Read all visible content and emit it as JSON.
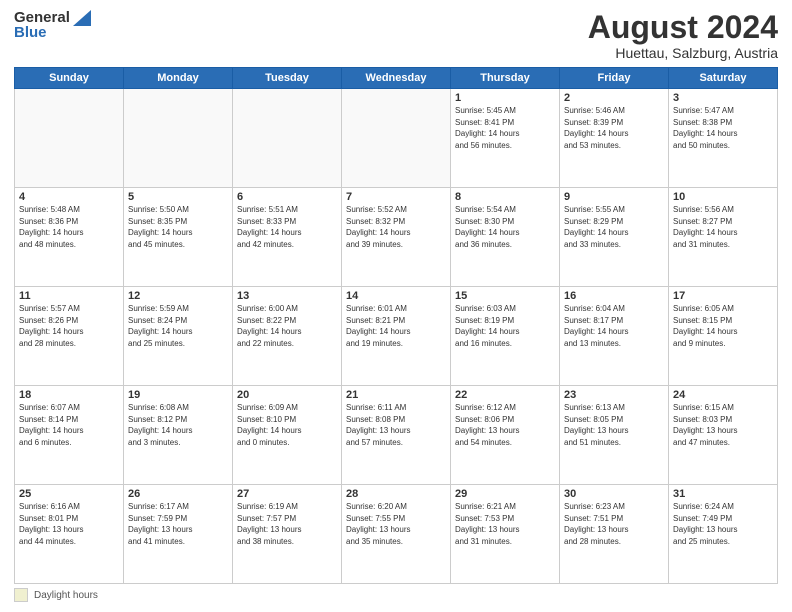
{
  "header": {
    "logo_general": "General",
    "logo_blue": "Blue",
    "month_year": "August 2024",
    "location": "Huettau, Salzburg, Austria"
  },
  "footer": {
    "daylight_label": "Daylight hours"
  },
  "weekdays": [
    "Sunday",
    "Monday",
    "Tuesday",
    "Wednesday",
    "Thursday",
    "Friday",
    "Saturday"
  ],
  "weeks": [
    [
      {
        "day": "",
        "info": ""
      },
      {
        "day": "",
        "info": ""
      },
      {
        "day": "",
        "info": ""
      },
      {
        "day": "",
        "info": ""
      },
      {
        "day": "1",
        "info": "Sunrise: 5:45 AM\nSunset: 8:41 PM\nDaylight: 14 hours\nand 56 minutes."
      },
      {
        "day": "2",
        "info": "Sunrise: 5:46 AM\nSunset: 8:39 PM\nDaylight: 14 hours\nand 53 minutes."
      },
      {
        "day": "3",
        "info": "Sunrise: 5:47 AM\nSunset: 8:38 PM\nDaylight: 14 hours\nand 50 minutes."
      }
    ],
    [
      {
        "day": "4",
        "info": "Sunrise: 5:48 AM\nSunset: 8:36 PM\nDaylight: 14 hours\nand 48 minutes."
      },
      {
        "day": "5",
        "info": "Sunrise: 5:50 AM\nSunset: 8:35 PM\nDaylight: 14 hours\nand 45 minutes."
      },
      {
        "day": "6",
        "info": "Sunrise: 5:51 AM\nSunset: 8:33 PM\nDaylight: 14 hours\nand 42 minutes."
      },
      {
        "day": "7",
        "info": "Sunrise: 5:52 AM\nSunset: 8:32 PM\nDaylight: 14 hours\nand 39 minutes."
      },
      {
        "day": "8",
        "info": "Sunrise: 5:54 AM\nSunset: 8:30 PM\nDaylight: 14 hours\nand 36 minutes."
      },
      {
        "day": "9",
        "info": "Sunrise: 5:55 AM\nSunset: 8:29 PM\nDaylight: 14 hours\nand 33 minutes."
      },
      {
        "day": "10",
        "info": "Sunrise: 5:56 AM\nSunset: 8:27 PM\nDaylight: 14 hours\nand 31 minutes."
      }
    ],
    [
      {
        "day": "11",
        "info": "Sunrise: 5:57 AM\nSunset: 8:26 PM\nDaylight: 14 hours\nand 28 minutes."
      },
      {
        "day": "12",
        "info": "Sunrise: 5:59 AM\nSunset: 8:24 PM\nDaylight: 14 hours\nand 25 minutes."
      },
      {
        "day": "13",
        "info": "Sunrise: 6:00 AM\nSunset: 8:22 PM\nDaylight: 14 hours\nand 22 minutes."
      },
      {
        "day": "14",
        "info": "Sunrise: 6:01 AM\nSunset: 8:21 PM\nDaylight: 14 hours\nand 19 minutes."
      },
      {
        "day": "15",
        "info": "Sunrise: 6:03 AM\nSunset: 8:19 PM\nDaylight: 14 hours\nand 16 minutes."
      },
      {
        "day": "16",
        "info": "Sunrise: 6:04 AM\nSunset: 8:17 PM\nDaylight: 14 hours\nand 13 minutes."
      },
      {
        "day": "17",
        "info": "Sunrise: 6:05 AM\nSunset: 8:15 PM\nDaylight: 14 hours\nand 9 minutes."
      }
    ],
    [
      {
        "day": "18",
        "info": "Sunrise: 6:07 AM\nSunset: 8:14 PM\nDaylight: 14 hours\nand 6 minutes."
      },
      {
        "day": "19",
        "info": "Sunrise: 6:08 AM\nSunset: 8:12 PM\nDaylight: 14 hours\nand 3 minutes."
      },
      {
        "day": "20",
        "info": "Sunrise: 6:09 AM\nSunset: 8:10 PM\nDaylight: 14 hours\nand 0 minutes."
      },
      {
        "day": "21",
        "info": "Sunrise: 6:11 AM\nSunset: 8:08 PM\nDaylight: 13 hours\nand 57 minutes."
      },
      {
        "day": "22",
        "info": "Sunrise: 6:12 AM\nSunset: 8:06 PM\nDaylight: 13 hours\nand 54 minutes."
      },
      {
        "day": "23",
        "info": "Sunrise: 6:13 AM\nSunset: 8:05 PM\nDaylight: 13 hours\nand 51 minutes."
      },
      {
        "day": "24",
        "info": "Sunrise: 6:15 AM\nSunset: 8:03 PM\nDaylight: 13 hours\nand 47 minutes."
      }
    ],
    [
      {
        "day": "25",
        "info": "Sunrise: 6:16 AM\nSunset: 8:01 PM\nDaylight: 13 hours\nand 44 minutes."
      },
      {
        "day": "26",
        "info": "Sunrise: 6:17 AM\nSunset: 7:59 PM\nDaylight: 13 hours\nand 41 minutes."
      },
      {
        "day": "27",
        "info": "Sunrise: 6:19 AM\nSunset: 7:57 PM\nDaylight: 13 hours\nand 38 minutes."
      },
      {
        "day": "28",
        "info": "Sunrise: 6:20 AM\nSunset: 7:55 PM\nDaylight: 13 hours\nand 35 minutes."
      },
      {
        "day": "29",
        "info": "Sunrise: 6:21 AM\nSunset: 7:53 PM\nDaylight: 13 hours\nand 31 minutes."
      },
      {
        "day": "30",
        "info": "Sunrise: 6:23 AM\nSunset: 7:51 PM\nDaylight: 13 hours\nand 28 minutes."
      },
      {
        "day": "31",
        "info": "Sunrise: 6:24 AM\nSunset: 7:49 PM\nDaylight: 13 hours\nand 25 minutes."
      }
    ]
  ]
}
